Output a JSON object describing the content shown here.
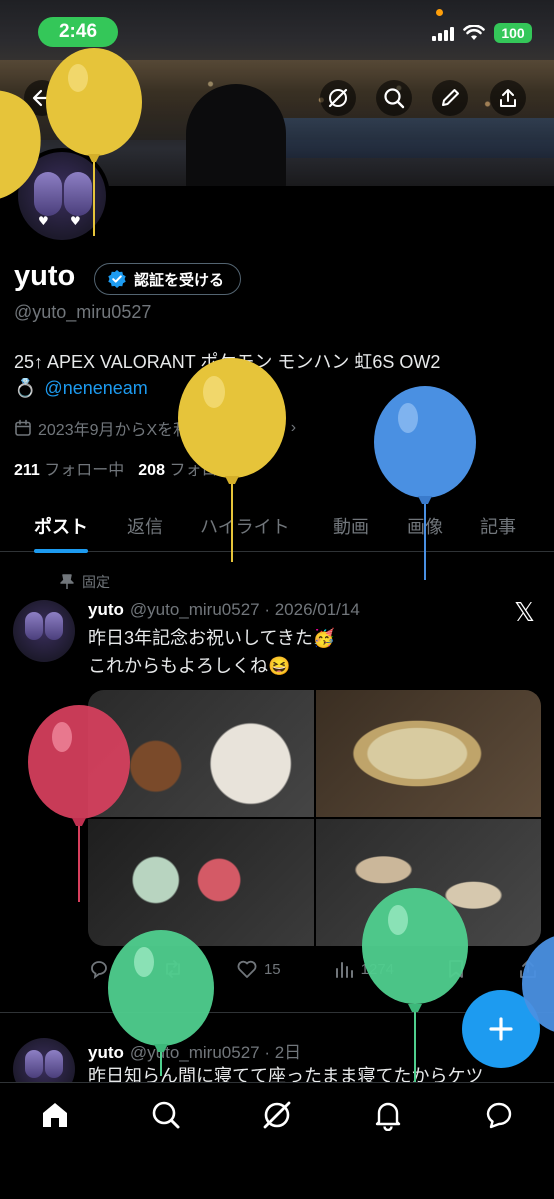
{
  "status_bar": {
    "time": "2:46",
    "battery": "100"
  },
  "profile": {
    "name": "yuto",
    "verify_label": "認証を受ける",
    "handle": "@yuto_miru0527",
    "bio_line1": "25↑ APEX VALORANT ポケモン モンハン 虹6S OW2",
    "bio_emoji": "💍",
    "bio_link": "@neneneam",
    "joined": "2023年9月からXを利用しています",
    "following_count": "211",
    "following_label": "フォロー中",
    "followers_count": "208",
    "followers_label": "フォロワー"
  },
  "tabs": [
    "ポスト",
    "返信",
    "ハイライト",
    "動画",
    "画像",
    "記事"
  ],
  "pinned_post": {
    "pinned_label": "固定",
    "name": "yuto",
    "meta": "@yuto_miru0527 · 2026/01/14",
    "line1": "昨日3年記念お祝いしてきた🥳",
    "line2": "これからもよろしくね😆",
    "likes": "15",
    "views": "1274"
  },
  "second_post": {
    "name": "yuto",
    "meta": "@yuto_miru0527 · 2日",
    "line1": "昨日知らん間に寝てて座ったまま寝てたからケツ"
  },
  "colors": {
    "accent": "#1d9bf0",
    "status_green": "#34c759",
    "muted": "#71767b"
  },
  "icons": [
    "back-arrow-icon",
    "grok-icon",
    "search-icon",
    "edit-icon",
    "share-icon",
    "pin-icon",
    "x-logo-icon",
    "reply-icon",
    "repost-icon",
    "heart-icon",
    "views-icon",
    "bookmark-icon",
    "compose-plus-icon",
    "home-icon",
    "notifications-icon",
    "messages-icon"
  ]
}
